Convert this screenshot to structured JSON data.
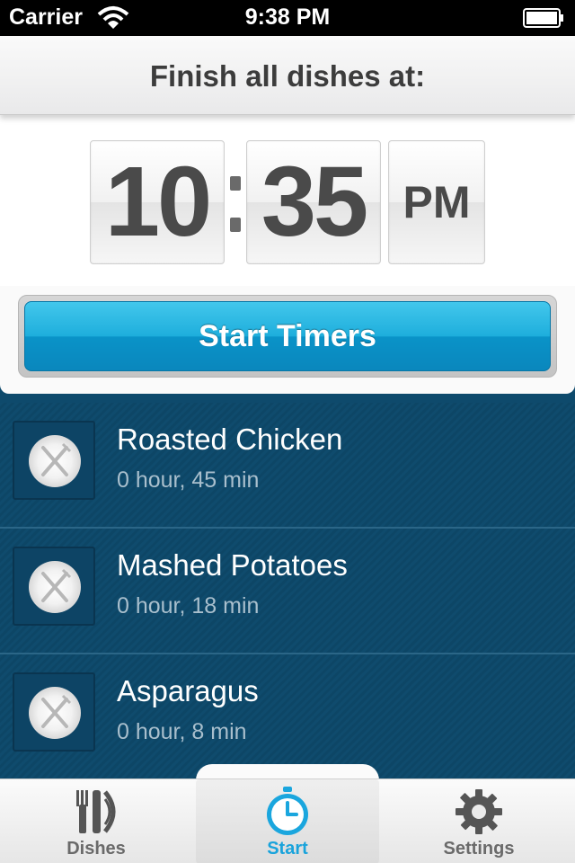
{
  "status_bar": {
    "carrier": "Carrier",
    "time": "9:38 PM"
  },
  "header": {
    "title": "Finish all dishes at:"
  },
  "time_picker": {
    "hour": "10",
    "minute": "35",
    "ampm": "PM"
  },
  "start_button": {
    "label": "Start Timers"
  },
  "dishes": [
    {
      "name": "Roasted Chicken",
      "time": "0 hour, 45 min"
    },
    {
      "name": "Mashed Potatoes",
      "time": "0 hour, 18 min"
    },
    {
      "name": "Asparagus",
      "time": "0 hour, 8 min"
    }
  ],
  "tabs": [
    {
      "label": "Dishes",
      "icon": "dishes-icon",
      "selected": false
    },
    {
      "label": "Start",
      "icon": "stopwatch-icon",
      "selected": true
    },
    {
      "label": "Settings",
      "icon": "gear-icon",
      "selected": false
    }
  ],
  "colors": {
    "accent": "#19a3db",
    "list_bg": "#0e4a6c"
  }
}
